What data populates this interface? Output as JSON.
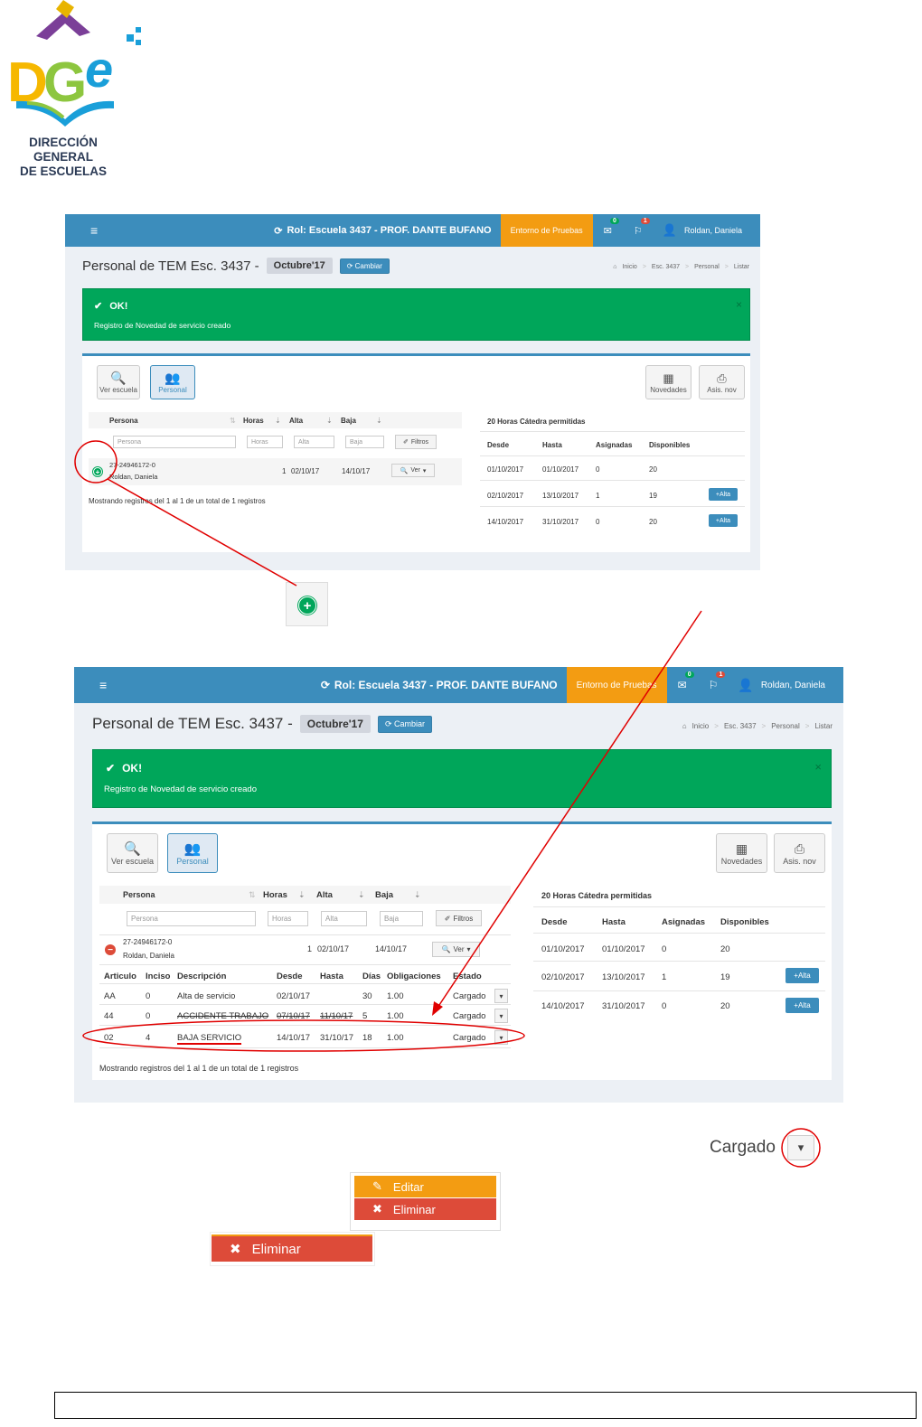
{
  "logo": {
    "letters": "DGe",
    "line1": "DIRECCIÓN GENERAL",
    "line2": "DE ESCUELAS"
  },
  "app": {
    "menu_icon": "hamburger-icon",
    "role": "Rol: Escuela 3437 - PROF. DANTE BUFANO",
    "env": "Entorno de Pruebas",
    "mail_badge": "0",
    "flag_badge": "1",
    "user": "Roldan, Daniela",
    "page_title": "Personal de TEM Esc. 3437 -",
    "period": "Octubre'17",
    "change_btn": "Cambiar",
    "breadcrumb": [
      "Inicio",
      "Esc. 3437",
      "Personal",
      "Listar"
    ],
    "alert_title": "OK!",
    "alert_msg": "Registro de Novedad de servicio creado",
    "alert_close": "×",
    "tiles": {
      "ver_escuela": "Ver escuela",
      "personal": "Personal",
      "novedades": "Novedades",
      "asis_nov": "Asis. nov"
    },
    "table_headers": {
      "persona": "Persona",
      "horas": "Horas",
      "alta": "Alta",
      "baja": "Baja"
    },
    "placeholders": {
      "persona": "Persona",
      "horas": "Horas",
      "alta": "Alta",
      "baja": "Baja"
    },
    "filtros_btn": "Filtros",
    "row": {
      "cuil": "27-24946172-0",
      "name": "Roldan, Daniela",
      "horas": "1",
      "alta": "02/10/17",
      "baja": "14/10/17",
      "ver_btn": "Ver"
    },
    "footer_text": "Mostrando registros del 1 al 1 de un total de 1 registros",
    "right_title": "20 Horas Cátedra permitidas",
    "right_headers": {
      "desde": "Desde",
      "hasta": "Hasta",
      "asignadas": "Asignadas",
      "disponibles": "Disponibles"
    },
    "right_rows": [
      {
        "desde": "01/10/2017",
        "hasta": "01/10/2017",
        "asignadas": "0",
        "disponibles": "20",
        "alta": ""
      },
      {
        "desde": "02/10/2017",
        "hasta": "13/10/2017",
        "asignadas": "1",
        "disponibles": "19",
        "alta": "Alta"
      },
      {
        "desde": "14/10/2017",
        "hasta": "31/10/2017",
        "asignadas": "0",
        "disponibles": "20",
        "alta": "Alta"
      }
    ],
    "detail_headers": {
      "articulo": "Articulo",
      "inciso": "Inciso",
      "descripcion": "Descripción",
      "desde": "Desde",
      "hasta": "Hasta",
      "dias": "Días",
      "obligaciones": "Obligaciones",
      "estado": "Estado"
    },
    "detail_rows": [
      {
        "articulo": "AA",
        "inciso": "0",
        "descripcion": "Alta de servicio",
        "desde": "02/10/17",
        "hasta": "",
        "dias": "30",
        "obligaciones": "1.00",
        "estado": "Cargado"
      },
      {
        "articulo": "44",
        "inciso": "0",
        "descripcion": "ACCIDENTE TRABAJO",
        "desde": "07/10/17",
        "hasta": "11/10/17",
        "dias": "5",
        "obligaciones": "1.00",
        "estado": "Cargado"
      },
      {
        "articulo": "02",
        "inciso": "4",
        "descripcion": "BAJA SERVICIO",
        "desde": "14/10/17",
        "hasta": "31/10/17",
        "dias": "18",
        "obligaciones": "1.00",
        "estado": "Cargado"
      }
    ]
  },
  "zoom": {
    "estado": "Cargado",
    "editar": "Editar",
    "eliminar": "Eliminar"
  },
  "colors": {
    "header_blue": "#3c8dbc",
    "orange": "#f39c12",
    "green": "#00a65a",
    "red": "#dd4b39",
    "annotation_red": "#e00000"
  }
}
